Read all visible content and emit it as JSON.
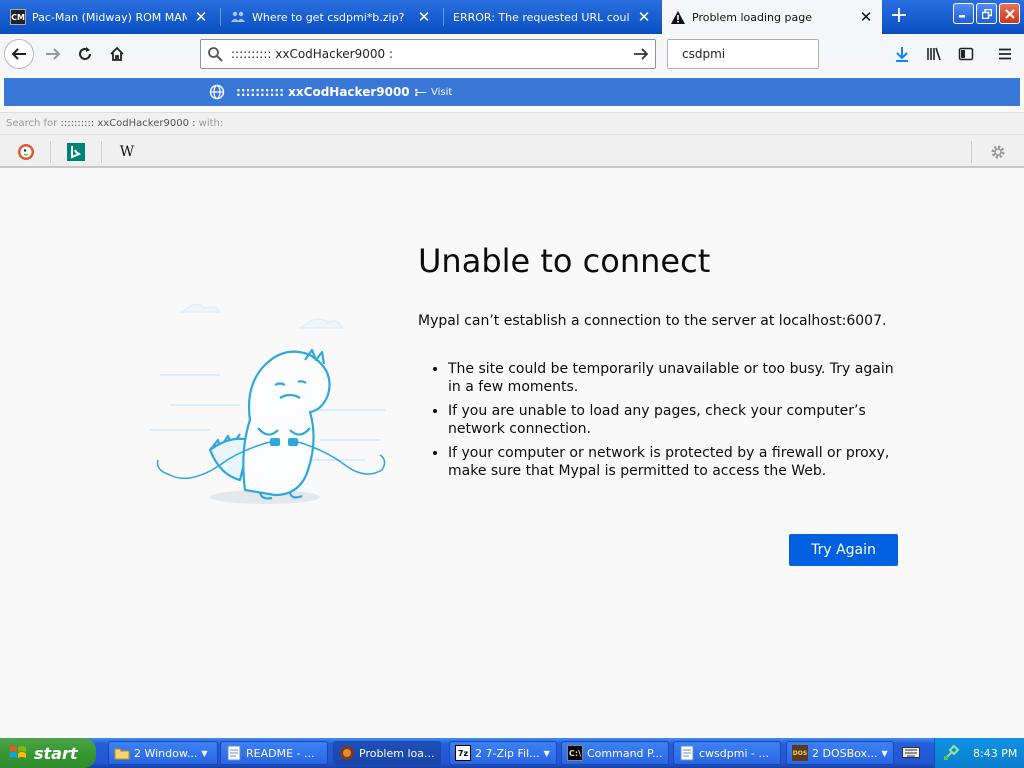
{
  "browser": {
    "tabs": [
      {
        "title": "Pac-Man (Midway) ROM MAME - C",
        "favicon": "arcade-icon",
        "active": false
      },
      {
        "title": "Where to get csdpmi*b.zip?",
        "favicon": "forum-icon",
        "active": false
      },
      {
        "title": "ERROR: The requested URL could not",
        "favicon": "none",
        "active": false
      },
      {
        "title": "Problem loading page",
        "favicon": "warning-icon",
        "active": true
      }
    ],
    "close_glyph": "✕",
    "newtab_glyph": "+",
    "url": ":::::::::: xxCodHacker9000 :",
    "search_value": "csdpmi",
    "suggestion": {
      "title": ":::::::::: xxCodHacker9000 :",
      "dash": "—",
      "action": "Visit"
    },
    "search_for": {
      "prefix": "Search for",
      "query": ":::::::::: xxCodHacker9000 :",
      "suffix": "with:"
    },
    "engines": [
      "duckduckgo-icon",
      "bing-icon",
      "wikipedia-icon"
    ],
    "wiki_glyph": "W"
  },
  "error_page": {
    "title": "Unable to connect",
    "description": "Mypal can’t establish a connection to the server at localhost:6007.",
    "suggestions": [
      "The site could be temporarily unavailable or too busy. Try again in a few moments.",
      "If you are unable to load any pages, check your computer’s network connection.",
      "If your computer or network is protected by a firewall or proxy, make sure that Mypal is permitted to access the Web."
    ],
    "button": "Try Again"
  },
  "taskbar": {
    "start": "start",
    "tasks": [
      {
        "label": "2 Window...",
        "icon": "folder-icon",
        "group": true
      },
      {
        "label": "README - ...",
        "icon": "notepad-icon",
        "group": false
      },
      {
        "label": "Problem loa...",
        "icon": "mypal-icon",
        "group": false
      },
      {
        "label": "2 7-Zip Fil...",
        "icon": "7zip-icon",
        "group": true
      },
      {
        "label": "Command P...",
        "icon": "cmd-icon",
        "group": false
      },
      {
        "label": "cwsdpmi - ...",
        "icon": "notepad-icon",
        "group": false
      },
      {
        "label": "2 DOSBox...",
        "icon": "dosbox-icon",
        "group": true
      }
    ],
    "clock": "8:43 PM"
  },
  "colors": {
    "accent": "#0060df",
    "titlebar": "#0a4fc2",
    "suggest_bg": "#3a78d8",
    "taskbar": "#245edb",
    "start_green": "#3a9a37"
  }
}
